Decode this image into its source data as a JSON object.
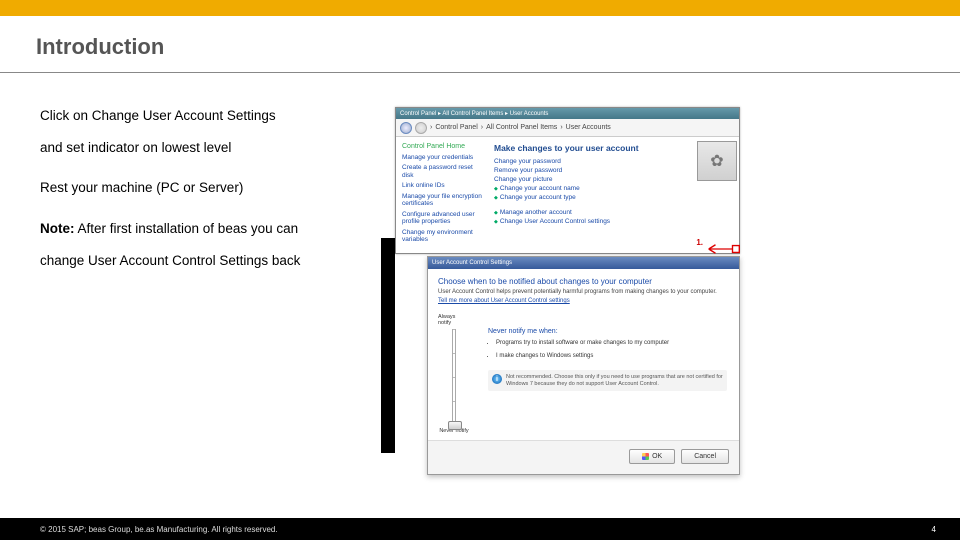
{
  "accent_bar_color": "#f0ab00",
  "title": "Introduction",
  "instructions": {
    "line1": "Click on Change User Account Settings",
    "line2": "and set indicator on lowest level",
    "line3": "Rest your machine (PC or Server)",
    "note_prefix": "Note:",
    "note_rest": " After first installation of beas you can",
    "note_line2": "change User Account Control Settings back"
  },
  "control_panel": {
    "titlebar": "Control Panel ▸ All Control Panel Items ▸ User Accounts",
    "breadcrumb_sep1": "›",
    "breadcrumb1": "Control Panel",
    "breadcrumb2": "All Control Panel Items",
    "breadcrumb3": "User Accounts",
    "side_head": "Control Panel Home",
    "side_links": [
      "Manage your credentials",
      "Create a password reset disk",
      "Link online IDs",
      "Manage your file encryption certificates",
      "Configure advanced user profile properties",
      "Change my environment variables"
    ],
    "main_heading": "Make changes to your user account",
    "main_links": [
      "Change your password",
      "Remove your password",
      "Change your picture",
      "Change your account name",
      "Change your account type"
    ],
    "bottom_links": [
      "Manage another account",
      "Change User Account Control settings"
    ],
    "marker": "1."
  },
  "uac": {
    "titlebar": "User Account Control Settings",
    "heading": "Choose when to be notified about changes to your computer",
    "sub1": "User Account Control helps prevent potentially harmful programs from making changes to your computer.",
    "link": "Tell me more about User Account Control settings",
    "slider_top": "Always notify",
    "slider_bottom": "Never notify",
    "info_title": "Never notify me when:",
    "bullets": [
      "Programs try to install software or make changes to my computer",
      "I make changes to Windows settings"
    ],
    "warn": "Not recommended. Choose this only if you need to use programs that are not certified for Windows 7 because they do not support User Account Control.",
    "ok": "OK",
    "cancel": "Cancel"
  },
  "footer": {
    "left": "© 2015 SAP; beas Group, be.as Manufacturing. All rights reserved.",
    "right": "4"
  }
}
